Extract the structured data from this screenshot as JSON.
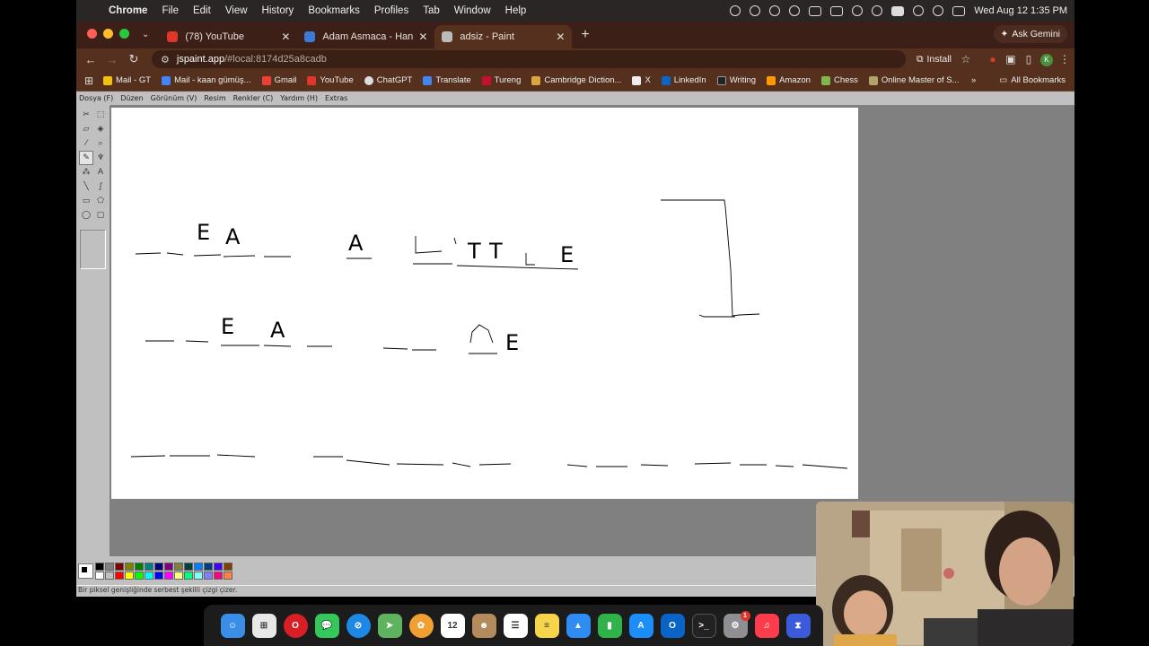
{
  "menubar": {
    "app_name": "Chrome",
    "items": [
      "File",
      "Edit",
      "View",
      "History",
      "Bookmarks",
      "Profiles",
      "Tab",
      "Window",
      "Help"
    ],
    "clock": "Wed Aug 12  1:35 PM"
  },
  "tabs": [
    {
      "title": "(78) YouTube",
      "icon": "youtube-icon",
      "color": "#e0352b"
    },
    {
      "title": "Adam Asmaca - Hangman",
      "icon": "puzzle-icon",
      "color": "#3a7bd5"
    },
    {
      "title": "adsiz - Paint",
      "icon": "paint-icon",
      "color": "#bbbbbb"
    }
  ],
  "ask_gemini": "Ask Gemini",
  "address": {
    "domain": "jspaint.app",
    "path": "/#local:8174d25a8cadb"
  },
  "install_label": "Install",
  "profile_initial": "K",
  "bookmarks": [
    {
      "label": "Mail - GT",
      "color": "#f4c20d"
    },
    {
      "label": "Mail - kaan gümüş...",
      "color": "#4285f4"
    },
    {
      "label": "Gmail",
      "color": "#ea4335"
    },
    {
      "label": "YouTube",
      "color": "#e0352b"
    },
    {
      "label": "ChatGPT",
      "color": "#dddddd"
    },
    {
      "label": "Translate",
      "color": "#4285f4"
    },
    {
      "label": "Tureng",
      "color": "#c8102e"
    },
    {
      "label": "Cambridge Diction...",
      "color": "#d9a441"
    },
    {
      "label": "X",
      "color": "#eeeeee"
    },
    {
      "label": "LinkedIn",
      "color": "#0a66c2"
    },
    {
      "label": "Writing",
      "color": "#222222"
    },
    {
      "label": "Amazon",
      "color": "#ff9900"
    },
    {
      "label": "Chess",
      "color": "#81b64c"
    },
    {
      "label": "Online Master of S...",
      "color": "#b3a369"
    }
  ],
  "all_bookmarks": "All Bookmarks",
  "paint": {
    "menu": [
      "Dosya (F)",
      "Düzen",
      "Görünüm (V)",
      "Resim",
      "Renkler (C)",
      "Yardım (H)",
      "Extras"
    ],
    "status": "Bir piksel genişliğinde serbest şekilli çizgi çizer.",
    "palette_top": [
      "#000000",
      "#808080",
      "#800000",
      "#808000",
      "#008000",
      "#008080",
      "#000080",
      "#800080",
      "#808040",
      "#004040",
      "#0080ff",
      "#004080",
      "#4000ff",
      "#804000"
    ],
    "palette_bottom": [
      "#ffffff",
      "#c0c0c0",
      "#ff0000",
      "#ffff00",
      "#00ff00",
      "#00ffff",
      "#0000ff",
      "#ff00ff",
      "#ffff80",
      "#00ff80",
      "#80ffff",
      "#8080ff",
      "#ff0080",
      "#ff8040"
    ],
    "canvas_letters": [
      "E",
      "A",
      "A",
      "T",
      "T",
      "E",
      "E",
      "A",
      "E"
    ]
  },
  "dock": [
    {
      "name": "finder-icon",
      "color": "#3a8ee6"
    },
    {
      "name": "launchpad-icon",
      "color": "#e8e8e8"
    },
    {
      "name": "opera-icon",
      "color": "#d81f26"
    },
    {
      "name": "messages-icon",
      "color": "#34c759"
    },
    {
      "name": "safari-icon",
      "color": "#1e88e5"
    },
    {
      "name": "maps-icon",
      "color": "#5fb35f"
    },
    {
      "name": "photos-icon",
      "color": "#f0a030"
    },
    {
      "name": "calendar-icon",
      "color": "#ffffff",
      "text": "12"
    },
    {
      "name": "contacts-icon",
      "color": "#b38b5d"
    },
    {
      "name": "reminders-icon",
      "color": "#ffffff"
    },
    {
      "name": "notes-icon",
      "color": "#f7d54a"
    },
    {
      "name": "keynote-icon",
      "color": "#2f8cf2"
    },
    {
      "name": "numbers-icon",
      "color": "#2fb24a"
    },
    {
      "name": "appstore-icon",
      "color": "#1c8ef9"
    },
    {
      "name": "outlook-icon",
      "color": "#0a64c8"
    },
    {
      "name": "terminal-icon",
      "color": "#222222"
    },
    {
      "name": "settings-icon",
      "color": "#8e8e93",
      "badge": "1"
    },
    {
      "name": "music-icon",
      "color": "#fa3c4c"
    },
    {
      "name": "screentime-icon",
      "color": "#3b5bdb"
    }
  ]
}
